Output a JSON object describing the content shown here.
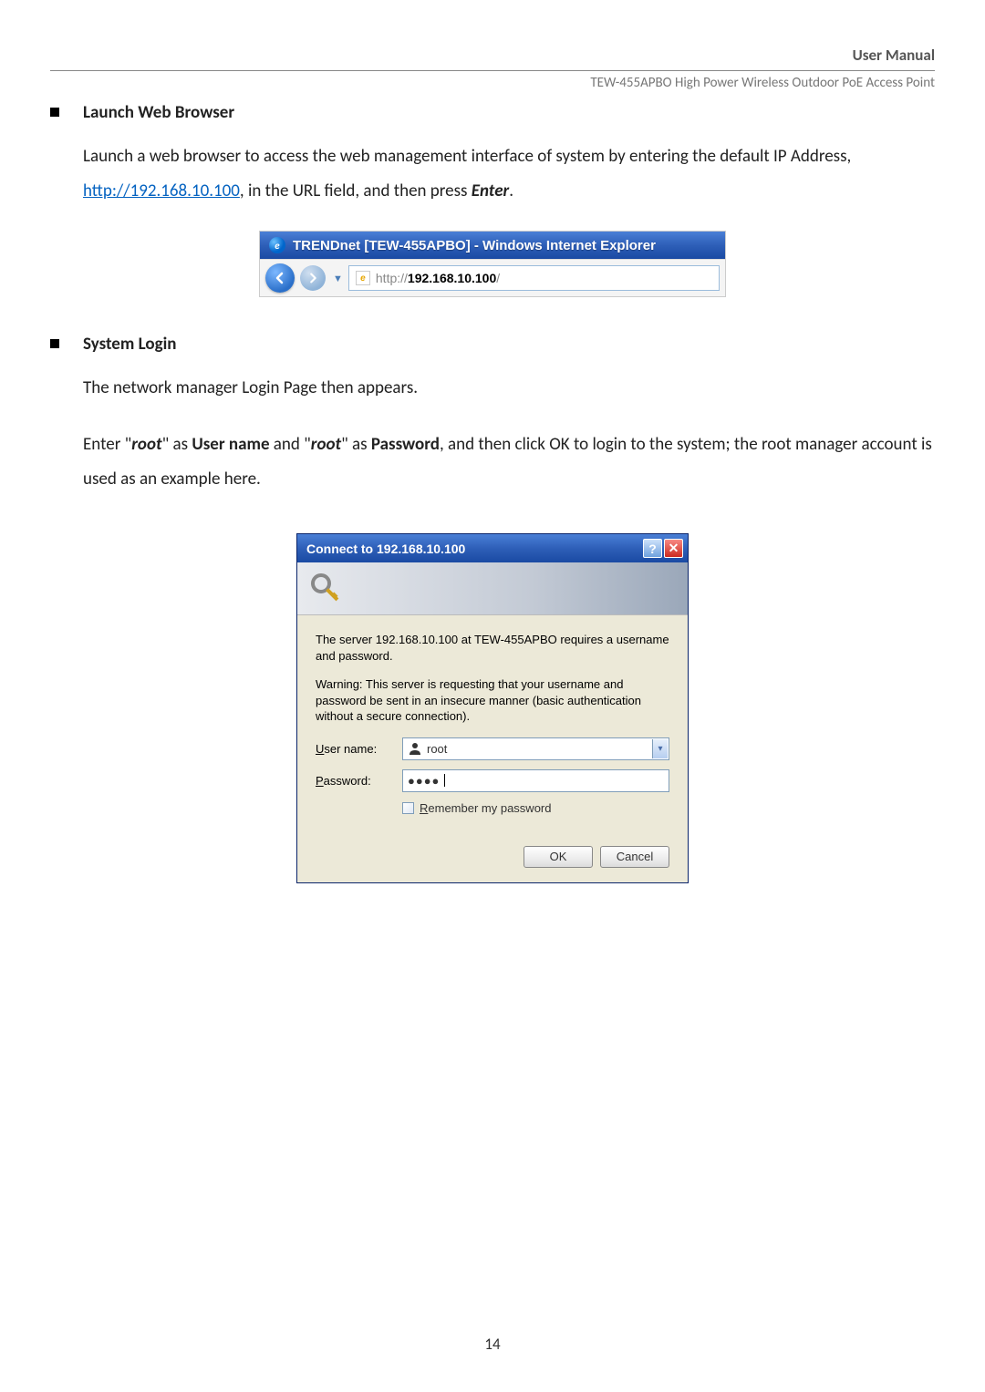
{
  "header": {
    "manual_label": "User Manual",
    "product": "TEW-455APBO High Power Wireless Outdoor PoE Access Point"
  },
  "section1": {
    "heading": "Launch Web Browser",
    "text_pre": "Launch a web browser to access the web management interface of system by entering the default IP Address, ",
    "link_text": "http://192.168.10.100",
    "text_mid": ", in the URL field, and then press ",
    "text_enter": "Enter",
    "text_post": "."
  },
  "ie_mockup": {
    "title": "TRENDnet [TEW-455APBO] - Windows Internet Explorer",
    "url_prefix": "http://",
    "url_host": "192.168.10.100",
    "url_suffix": "/"
  },
  "section2": {
    "heading": "System Login",
    "line1": "The network manager Login Page then appears.",
    "line2_a": "Enter \"",
    "line2_root1": "root",
    "line2_b": "\" as ",
    "line2_user": "User name",
    "line2_c": " and \"",
    "line2_root2": "root",
    "line2_d": "\" as ",
    "line2_pw": "Password",
    "line2_e": ", and then click OK to login to the system; the root manager account is used as an example here."
  },
  "auth_dialog": {
    "title": "Connect to 192.168.10.100",
    "msg1": "The server 192.168.10.100 at TEW-455APBO requires a username and password.",
    "msg2": "Warning: This server is requesting that your username and password be sent in an insecure manner (basic authentication without a secure connection).",
    "user_label_u": "U",
    "user_label_rest": "ser name:",
    "user_value": "root",
    "pw_label_u": "P",
    "pw_label_rest": "assword:",
    "pw_dots": "●●●●",
    "remember_u": "R",
    "remember_rest": "emember my password",
    "ok": "OK",
    "cancel": "Cancel"
  },
  "page_number": "14"
}
